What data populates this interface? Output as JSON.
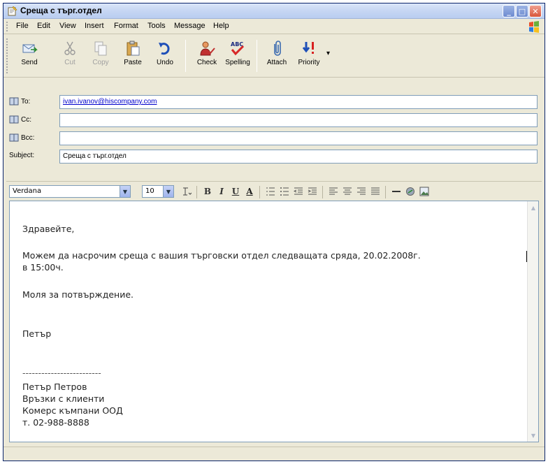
{
  "window": {
    "title": "Среща с търг.отдел",
    "minimize_label": "_",
    "maximize_label": "□",
    "close_label": "✕"
  },
  "menu": [
    "File",
    "Edit",
    "View",
    "Insert",
    "Format",
    "Tools",
    "Message",
    "Help"
  ],
  "toolbar": {
    "send": "Send",
    "cut": "Cut",
    "copy": "Copy",
    "paste": "Paste",
    "undo": "Undo",
    "check": "Check",
    "spelling": "Spelling",
    "attach": "Attach",
    "priority": "Priority"
  },
  "header": {
    "to_label": "To:",
    "to_value": "ivan.ivanov@hiscompany.com",
    "cc_label": "Cc:",
    "cc_value": "",
    "bcc_label": "Bcc:",
    "bcc_value": "",
    "subject_label": "Subject:",
    "subject_value": "Среща с търг.отдел"
  },
  "format": {
    "font": "Verdana",
    "size": "10",
    "bold": "B",
    "italic": "I",
    "underline": "U",
    "font_color": "A"
  },
  "body": {
    "greeting": "Здравейте,",
    "para1_line1": "Можем да насрочим среща с вашия търговски отдел следващата сряда, 20.02.2008г.",
    "para1_line2": "в 15:00ч.",
    "para2": "Моля за потвърждение.",
    "sign_name": "Петър",
    "divider": "-------------------------",
    "sig_line1": "Петър Петров",
    "sig_line2": "Връзки с клиенти",
    "sig_line3": "Комерс къмпани ООД",
    "sig_line4": "т. 02-988-8888"
  },
  "colors": {
    "title_gradient_top": "#dbe6f8",
    "close_button": "#d8563c",
    "link": "#0000cc",
    "chrome": "#ece9d8"
  }
}
